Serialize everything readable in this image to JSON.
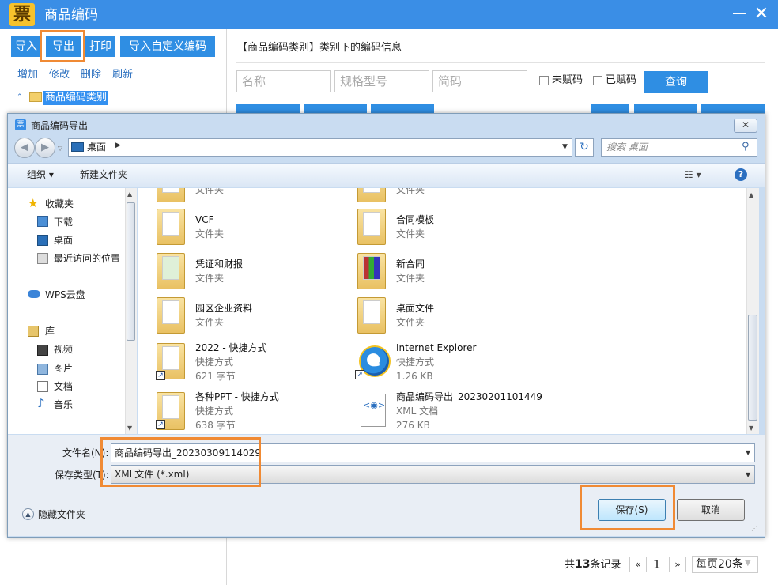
{
  "app": {
    "logo": "票",
    "title": "商品编码",
    "close": "✕"
  },
  "toolbar": {
    "import": "导入",
    "export": "导出",
    "print": "打印",
    "import_custom": "导入自定义编码"
  },
  "actions": {
    "add": "增加",
    "edit": "修改",
    "delete": "删除",
    "refresh": "刷新"
  },
  "tree": {
    "root": "商品编码类别"
  },
  "main": {
    "heading": "【商品编码类别】类别下的编码信息",
    "filters": {
      "name_placeholder": "名称",
      "spec_placeholder": "规格型号",
      "abbr_placeholder": "简码"
    },
    "unassigned_label": "未赋码",
    "assigned_label": "已赋码",
    "query_label": "查询"
  },
  "pagination": {
    "total_prefix": "共",
    "total_count": "13",
    "total_suffix": "条记录",
    "prev": "«",
    "page": "1",
    "next": "»",
    "page_size": "每页20条"
  },
  "dialog": {
    "title": "商品编码导出",
    "address": {
      "location": "桌面",
      "search_placeholder": "搜索 桌面"
    },
    "commands": {
      "organize": "组织 ▾",
      "new_folder": "新建文件夹"
    },
    "nav": {
      "favorites": "收藏夹",
      "downloads": "下载",
      "desktop": "桌面",
      "recent": "最近访问的位置",
      "wps": "WPS云盘",
      "libraries": "库",
      "videos": "视频",
      "pictures": "图片",
      "documents": "文档",
      "music": "音乐"
    },
    "files": [
      {
        "name": "",
        "type": "文件夹"
      },
      {
        "name": "",
        "type": "文件夹"
      },
      {
        "name": "VCF",
        "type": "文件夹"
      },
      {
        "name": "合同模板",
        "type": "文件夹"
      },
      {
        "name": "凭证和财报",
        "type": "文件夹"
      },
      {
        "name": "新合同",
        "type": "文件夹"
      },
      {
        "name": "园区企业资料",
        "type": "文件夹"
      },
      {
        "name": "桌面文件",
        "type": "文件夹"
      },
      {
        "name": "2022 - 快捷方式",
        "type": "快捷方式",
        "size": "621 字节"
      },
      {
        "name": "Internet Explorer",
        "type": "快捷方式",
        "size": "1.26 KB"
      },
      {
        "name": "各种PPT - 快捷方式",
        "type": "快捷方式",
        "size": "638 字节"
      },
      {
        "name": "商品编码导出_20230201101449",
        "type": "XML 文档",
        "size": "276 KB"
      }
    ],
    "filename_label": "文件名(N):",
    "filename_value": "商品编码导出_20230309114029",
    "filetype_label": "保存类型(T):",
    "filetype_value": "XML文件 (*.xml)",
    "hide_folders": "隐藏文件夹",
    "save": "保存(S)",
    "cancel": "取消"
  },
  "colors": {
    "accent": "#3a8ee6",
    "highlight": "#f08a34"
  }
}
